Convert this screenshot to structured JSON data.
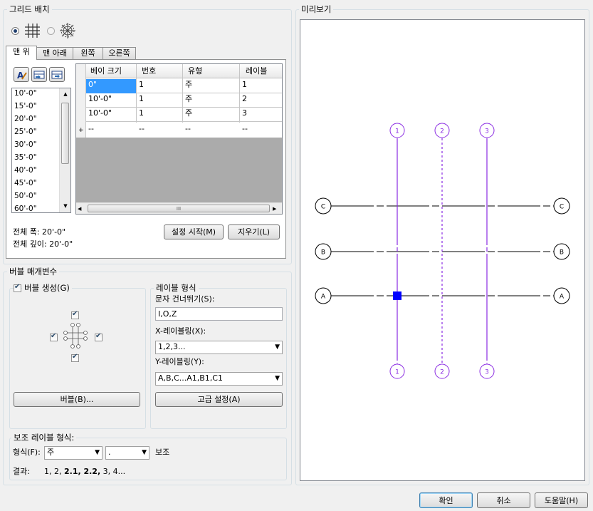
{
  "grid_placement": {
    "title": "그리드 배치",
    "tabs": [
      "맨 위",
      "맨 아래",
      "왼쪽",
      "오른쪽"
    ],
    "spacing_list": [
      "10'-0\"",
      "15'-0\"",
      "20'-0\"",
      "25'-0\"",
      "30'-0\"",
      "35'-0\"",
      "40'-0\"",
      "45'-0\"",
      "50'-0\"",
      "60'-0\""
    ],
    "table": {
      "headers": [
        "베이 크기",
        "번호",
        "유형",
        "레이블"
      ],
      "rows": [
        [
          "0\"",
          "1",
          "주",
          "1"
        ],
        [
          "10'-0\"",
          "1",
          "주",
          "2"
        ],
        [
          "10'-0\"",
          "1",
          "주",
          "3"
        ]
      ],
      "new_row": [
        "--",
        "--",
        "--",
        "--"
      ],
      "new_row_marker": "+",
      "scroll_mark": "III"
    },
    "total_width": "전체 폭: 20'-0\"",
    "total_depth": "전체 깊이: 20'-0\"",
    "setup_button": "설정 시작(M)",
    "clear_button": "지우기(L)"
  },
  "bubble_params": {
    "title": "버블 매개변수",
    "create_bubble": "버블 생성(G)",
    "bubble_button": "버블(B)...",
    "label_format": {
      "title": "레이블 형식",
      "skip_chars_label": "문자 건너뛰기(S):",
      "skip_chars_value": "I,O,Z",
      "x_label": "X-레이블링(X):",
      "x_value": "1,2,3...",
      "y_label": "Y-레이블링(Y):",
      "y_value": "A,B,C...A1,B1,C1",
      "advanced_button": "고급 설정(A)"
    }
  },
  "sub_label": {
    "title": "보조 레이블 형식:",
    "format_label": "형식(F):",
    "format_value": "주",
    "separator_value": ".",
    "sub_text": "보조",
    "result_label": "결과:",
    "result_plain1": "1, 2, ",
    "result_bold": "2.1, 2.2,",
    "result_plain2": " 3, 4..."
  },
  "preview": {
    "title": "미리보기",
    "columns": [
      "1",
      "2",
      "3"
    ],
    "rows": [
      "C",
      "B",
      "A"
    ],
    "grid_color": "#8a2be2"
  },
  "footer": {
    "ok": "확인",
    "cancel": "취소",
    "help": "도움말(H)"
  }
}
